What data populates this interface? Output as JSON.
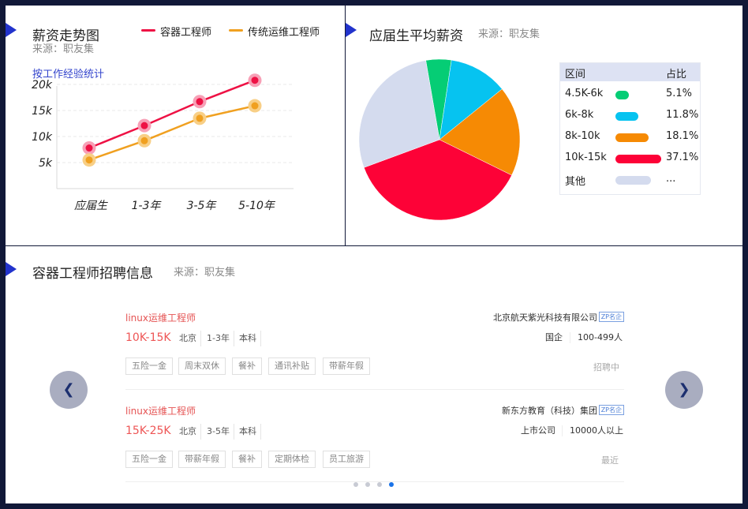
{
  "trend": {
    "title": "薪资走势图",
    "source": "来源：职友集",
    "subtitle": "按工作经验统计",
    "legend": [
      {
        "label": "容器工程师",
        "color": "#ee1144"
      },
      {
        "label": "传统运维工程师",
        "color": "#f0a020"
      }
    ]
  },
  "pie": {
    "title": "应届生平均薪资",
    "source": "来源：职友集",
    "table": {
      "header": {
        "range": "区间",
        "share": "占比"
      },
      "rows": [
        {
          "range": "4.5K-6k",
          "share": "5.1%",
          "color": "#05cd75",
          "swatch_ratio": 0.3
        },
        {
          "range": "6k-8k",
          "share": "11.8%",
          "color": "#06c3f0",
          "swatch_ratio": 0.5
        },
        {
          "range": "8k-10k",
          "share": "18.1%",
          "color": "#f68a04",
          "swatch_ratio": 0.72
        },
        {
          "range": "10k-15k",
          "share": "37.1%",
          "color": "#fd0237",
          "swatch_ratio": 1.0
        },
        {
          "range": "其他",
          "share": "...",
          "color": "#d4dbee",
          "swatch_ratio": 0.78
        }
      ]
    }
  },
  "chart_data": [
    {
      "type": "line",
      "categories": [
        "应届生",
        "1-3年",
        "3-5年",
        "5-10年"
      ],
      "series": [
        {
          "name": "容器工程师",
          "values": [
            7.8,
            12.1,
            16.7,
            20.8
          ],
          "color": "#ee1144"
        },
        {
          "name": "传统运维工程师",
          "values": [
            5.5,
            9.2,
            13.5,
            15.9
          ],
          "color": "#f0a020"
        }
      ],
      "y_ticks": [
        {
          "value": 5,
          "label": "5k"
        },
        {
          "value": 10,
          "label": "10k"
        },
        {
          "value": 15,
          "label": "15k"
        },
        {
          "value": 20,
          "label": "20k"
        }
      ],
      "ylim": [
        0,
        22
      ],
      "grid": true
    },
    {
      "type": "pie",
      "slices": [
        {
          "label": "4.5K-6k",
          "value": 5.1,
          "color": "#05cd75"
        },
        {
          "label": "6k-8k",
          "value": 11.8,
          "color": "#06c3f0"
        },
        {
          "label": "8k-10k",
          "value": 18.1,
          "color": "#f68a04"
        },
        {
          "label": "10k-15k",
          "value": 37.1,
          "color": "#fd0237"
        },
        {
          "label": "其他",
          "value": 27.9,
          "color": "#d4dbee"
        }
      ]
    }
  ],
  "jobs": {
    "title": "容器工程师招聘信息",
    "source": "来源：职友集",
    "prev_icon": "❮",
    "next_icon": "❯",
    "items": [
      {
        "title": "linux运维工程师",
        "salary": "10K-15K",
        "meta": [
          "北京",
          "1-3年",
          "本科"
        ],
        "tags": [
          "五险一金",
          "周末双休",
          "餐补",
          "通讯补贴",
          "带薪年假"
        ],
        "company": "北京航天紫光科技有限公司",
        "badge": "ZP名企",
        "info": [
          "国企",
          "100-499人"
        ],
        "status": "招聘中"
      },
      {
        "title": "linux运维工程师",
        "salary": "15K-25K",
        "meta": [
          "北京",
          "3-5年",
          "本科"
        ],
        "tags": [
          "五险一金",
          "带薪年假",
          "餐补",
          "定期体检",
          "员工旅游"
        ],
        "company": "新东方教育（科技）集团",
        "badge": "ZP名企",
        "info": [
          "上市公司",
          "10000人以上"
        ],
        "status": "最近"
      }
    ],
    "pagination": {
      "count": 4,
      "active": 3,
      "active_color": "#1a73e8"
    }
  }
}
